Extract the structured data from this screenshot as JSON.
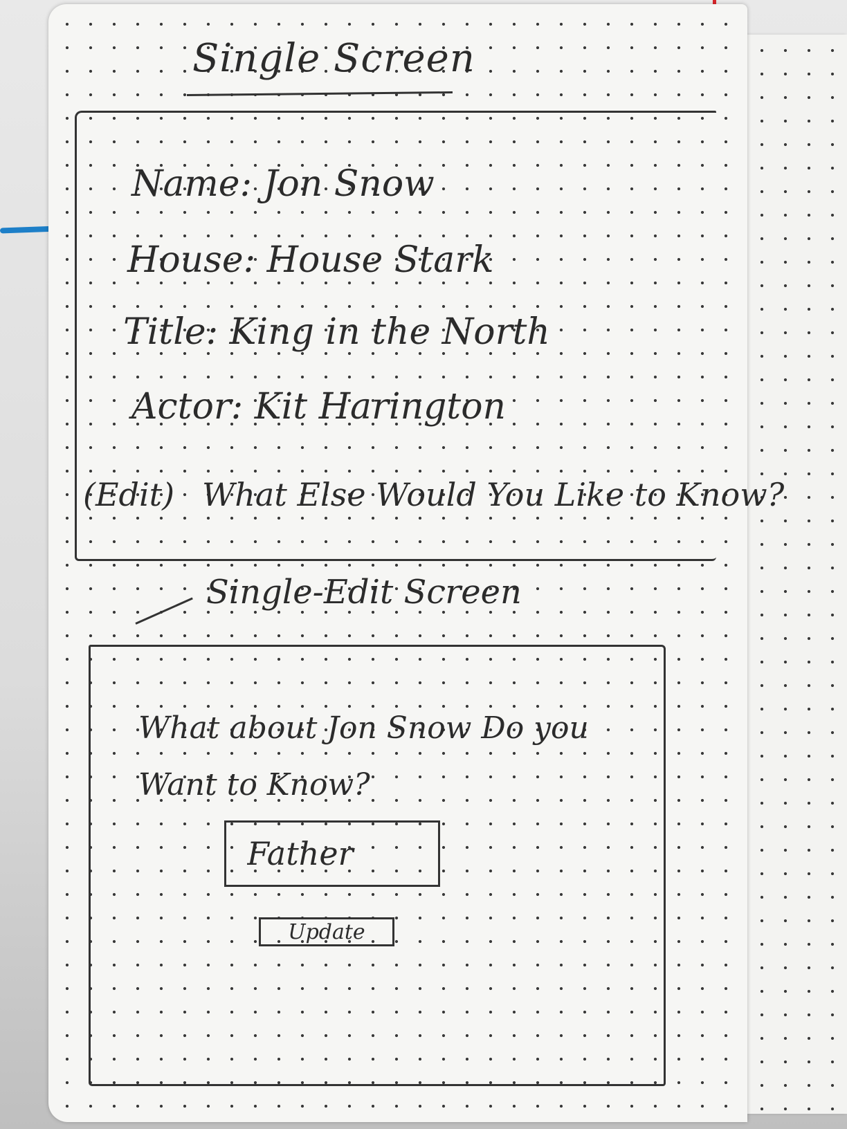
{
  "single_screen": {
    "title": "Single Screen",
    "fields": {
      "name": "Name: Jon Snow",
      "house": "House: House Stark",
      "title": "Title: King in the North",
      "actor": "Actor: Kit Harington"
    },
    "edit_label": "(Edit)",
    "prompt": "What Else Would You Like to Know?"
  },
  "single_edit_screen": {
    "title": "Single-Edit Screen",
    "question_line1": "What about Jon Snow Do you",
    "question_line2": "Want to Know?",
    "answer_value": "Father",
    "update_label": "Update"
  }
}
